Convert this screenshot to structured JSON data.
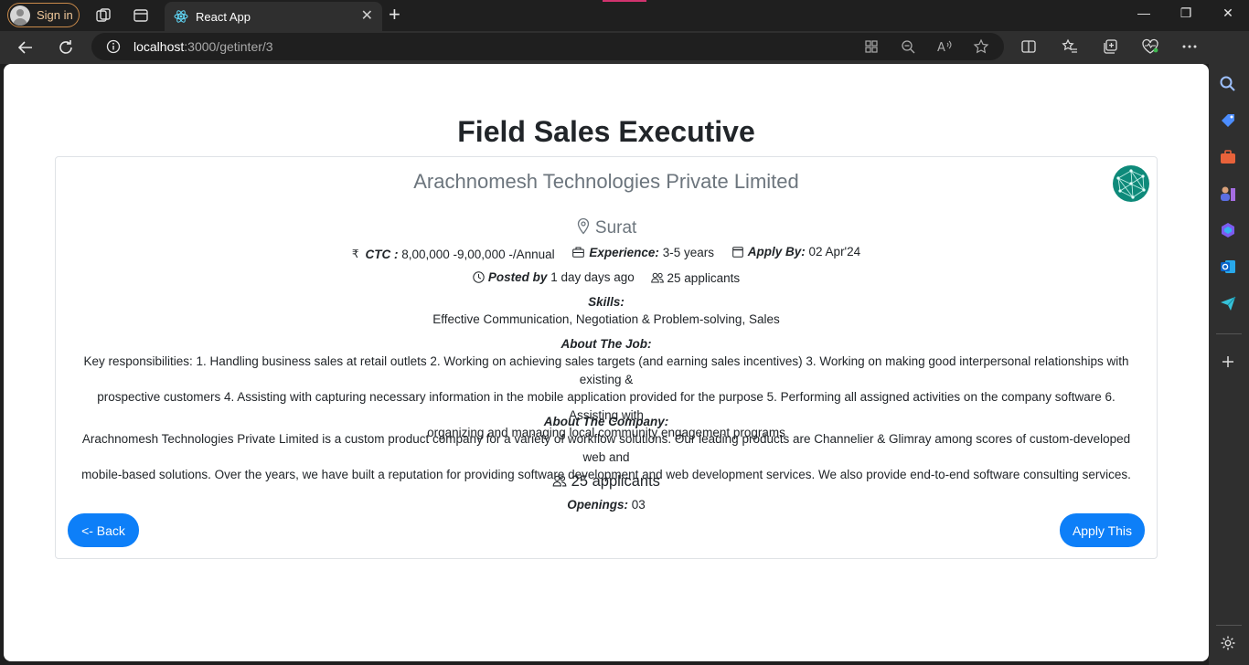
{
  "browser": {
    "signin_label": "Sign in",
    "tab_title": "React App",
    "url_host": "localhost",
    "url_rest": ":3000/getinter/3"
  },
  "job": {
    "title": "Field Sales Executive",
    "company": "Arachnomesh Technologies Private Limited",
    "location": "Surat",
    "ctc_label": "CTC :",
    "ctc_value": "8,00,000 -9,00,000 -/Annual",
    "experience_label": "Experience:",
    "experience_value": "3-5 years",
    "apply_by_label": "Apply By:",
    "apply_by_value": "02 Apr'24",
    "posted_label": "Posted by",
    "posted_value": "1 day days ago",
    "applicants": "25 applicants",
    "skills_label": "Skills:",
    "skills": "Effective Communication, Negotiation & Problem-solving, Sales",
    "about_job_label": "About The Job:",
    "about_job_lines": [
      "Key responsibilities: 1. Handling business sales at retail outlets 2. Working on achieving sales targets (and earning sales incentives) 3. Working on making good interpersonal relationships with existing &",
      "prospective customers 4. Assisting with capturing necessary information in the mobile application provided for the purpose 5. Performing all assigned activities on the company software 6. Assisting with",
      "organizing and managing local community engagement programs"
    ],
    "about_company_label": "About The Company:",
    "about_company_lines": [
      "Arachnomesh Technologies Private Limited is a custom product company for a variety of workflow solutions. Our leading products are Channelier & Glimray among scores of custom-developed web and",
      "mobile-based solutions. Over the years, we have built a reputation for providing software development and web development services. We also provide end-to-end software consulting services."
    ],
    "applicants_footer": "25 applicants",
    "openings_label": "Openings:",
    "openings_value": "03",
    "back_label": "<- Back",
    "apply_label": "Apply This"
  },
  "colors": {
    "primary_button": "#0d7ff8",
    "logo_bg": "#0e8a7a",
    "muted_text": "#6c757d"
  }
}
